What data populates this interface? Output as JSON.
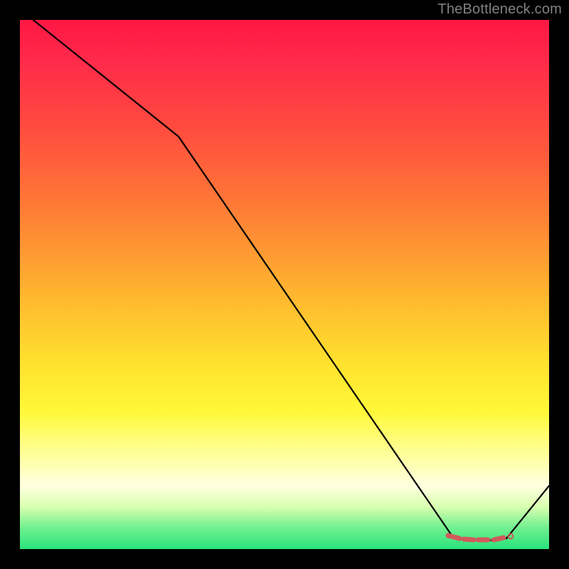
{
  "attribution": "TheBottleneck.com",
  "chart_data": {
    "type": "line",
    "title": "",
    "xlabel": "",
    "ylabel": "",
    "xlim": [
      0,
      100
    ],
    "ylim": [
      0,
      100
    ],
    "series": [
      {
        "name": "curve",
        "x": [
          0,
          30,
          82,
          92,
          100
        ],
        "values": [
          102,
          78,
          2,
          2,
          12
        ]
      }
    ],
    "annotations": [
      {
        "name": "highlighted-segment",
        "x": [
          82,
          84,
          86,
          88,
          90,
          92
        ],
        "values": [
          2.2,
          2.0,
          2.0,
          2.0,
          2.0,
          2.2
        ]
      }
    ],
    "background_gradient": {
      "top": "#ff1744",
      "mid": "#ffe22e",
      "bottom": "#29e27a"
    }
  }
}
